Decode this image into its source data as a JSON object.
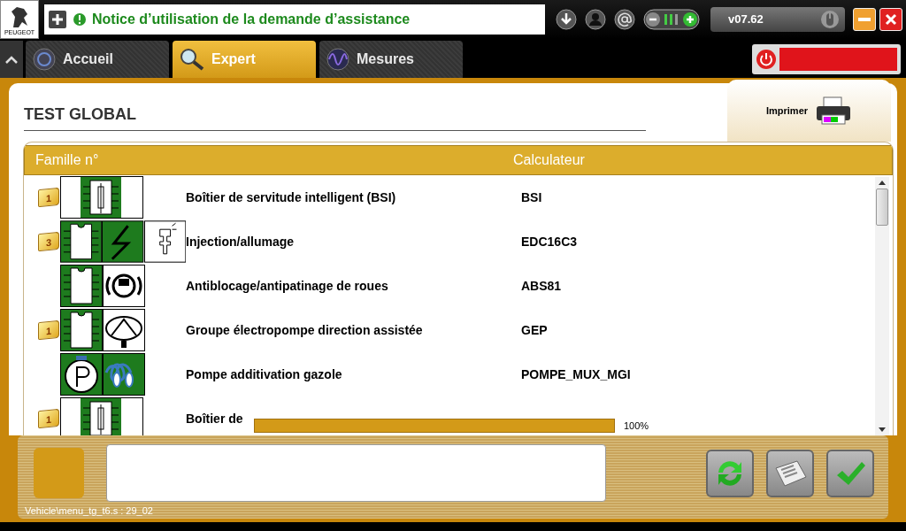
{
  "title_bar": {
    "logo_text": "PEUGEOT",
    "title": "Notice d’utilisation de la demande d’assistance",
    "version": "v07.62"
  },
  "tabs": [
    {
      "label": "Accueil",
      "kind": "home",
      "selected": false
    },
    {
      "label": "Expert",
      "kind": "expert",
      "selected": true
    },
    {
      "label": "Mesures",
      "kind": "measures",
      "selected": false
    }
  ],
  "page": {
    "title": "TEST GLOBAL",
    "print_label": "Imprimer"
  },
  "table": {
    "columns": [
      "Famille n°",
      "Calculateur"
    ],
    "rows": [
      {
        "badge": "1",
        "icons": [
          {
            "kind": "bsi"
          }
        ],
        "name": "Boîtier de servitude intelligent (BSI)",
        "calculator": "BSI"
      },
      {
        "badge": "3",
        "icons": [
          {
            "kind": "ecu"
          },
          {
            "kind": "lightning"
          },
          {
            "kind": "injector"
          }
        ],
        "name": "Injection/allumage",
        "calculator": "EDC16C3"
      },
      {
        "icons": [
          {
            "kind": "ecu"
          },
          {
            "kind": "abs"
          }
        ],
        "name": "Antiblocage/antipatinage de roues",
        "calculator": "ABS81"
      },
      {
        "badge": "1",
        "icons": [
          {
            "kind": "ecu"
          },
          {
            "kind": "steering"
          }
        ],
        "name": "Groupe électropompe direction assistée",
        "calculator": "GEP"
      },
      {
        "icons": [
          {
            "kind": "pump"
          },
          {
            "kind": "coil"
          }
        ],
        "name": "Pompe additivation gazole",
        "calculator": "POMPE_MUX_MGI"
      },
      {
        "badge": "1",
        "icons": [
          {
            "kind": "bsi"
          }
        ],
        "name": "Boîtier de"
      }
    ]
  },
  "progress": {
    "level": 1,
    "reading": "100%"
  },
  "status_path": "Vehicle\\menu_tg_t6.s : 29_02"
}
